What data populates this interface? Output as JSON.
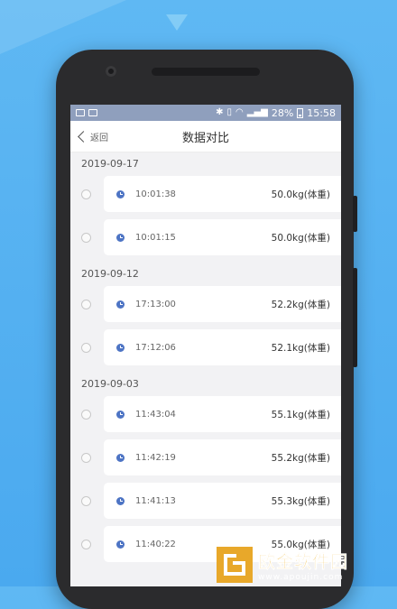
{
  "status_bar": {
    "battery": "28%",
    "time": "15:58"
  },
  "nav": {
    "back_label": "返回",
    "title": "数据对比"
  },
  "groups": [
    {
      "date": "2019-09-17",
      "records": [
        {
          "time": "10:01:38",
          "value": "50.0kg(体重)"
        },
        {
          "time": "10:01:15",
          "value": "50.0kg(体重)"
        }
      ]
    },
    {
      "date": "2019-09-12",
      "records": [
        {
          "time": "17:13:00",
          "value": "52.2kg(体重)"
        },
        {
          "time": "17:12:06",
          "value": "52.1kg(体重)"
        }
      ]
    },
    {
      "date": "2019-09-03",
      "records": [
        {
          "time": "11:43:04",
          "value": "55.1kg(体重)"
        },
        {
          "time": "11:42:19",
          "value": "55.2kg(体重)"
        },
        {
          "time": "11:41:13",
          "value": "55.3kg(体重)"
        },
        {
          "time": "11:40:22",
          "value": "55.0kg(体重)"
        }
      ]
    }
  ],
  "watermark": {
    "name": "欧金软件园",
    "url": "www.apoujin.com"
  },
  "colors": {
    "background": "#4aa9ef",
    "status_bar": "#8f9fbd",
    "clock_icon": "#4d74c4",
    "watermark": "#f0b52f"
  }
}
